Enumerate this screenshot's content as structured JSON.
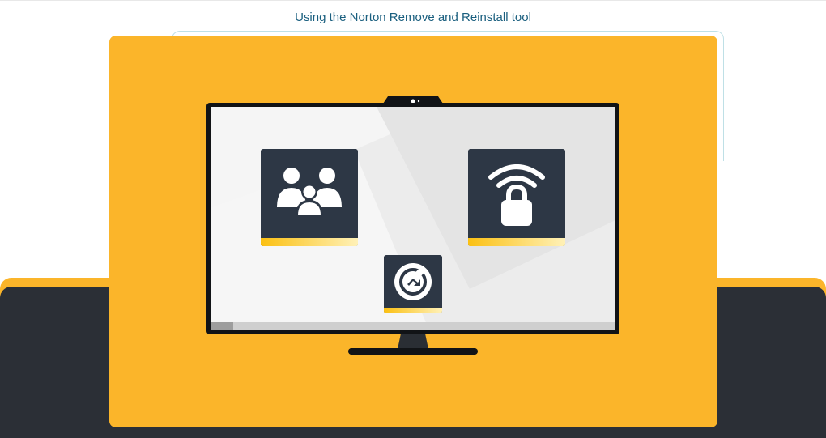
{
  "caption": {
    "title": "Using the Norton Remove and Reinstall tool"
  },
  "colors": {
    "brand_yellow": "#fbb52a",
    "dark_navy": "#2b2f36",
    "tile_navy": "#2d3745",
    "caption_teal": "#1a5f7f"
  },
  "screen": {
    "tiles": [
      {
        "icon": "family-icon"
      },
      {
        "icon": "wifi-lock-icon"
      },
      {
        "icon": "norton-remove-reinstall-icon"
      }
    ]
  }
}
